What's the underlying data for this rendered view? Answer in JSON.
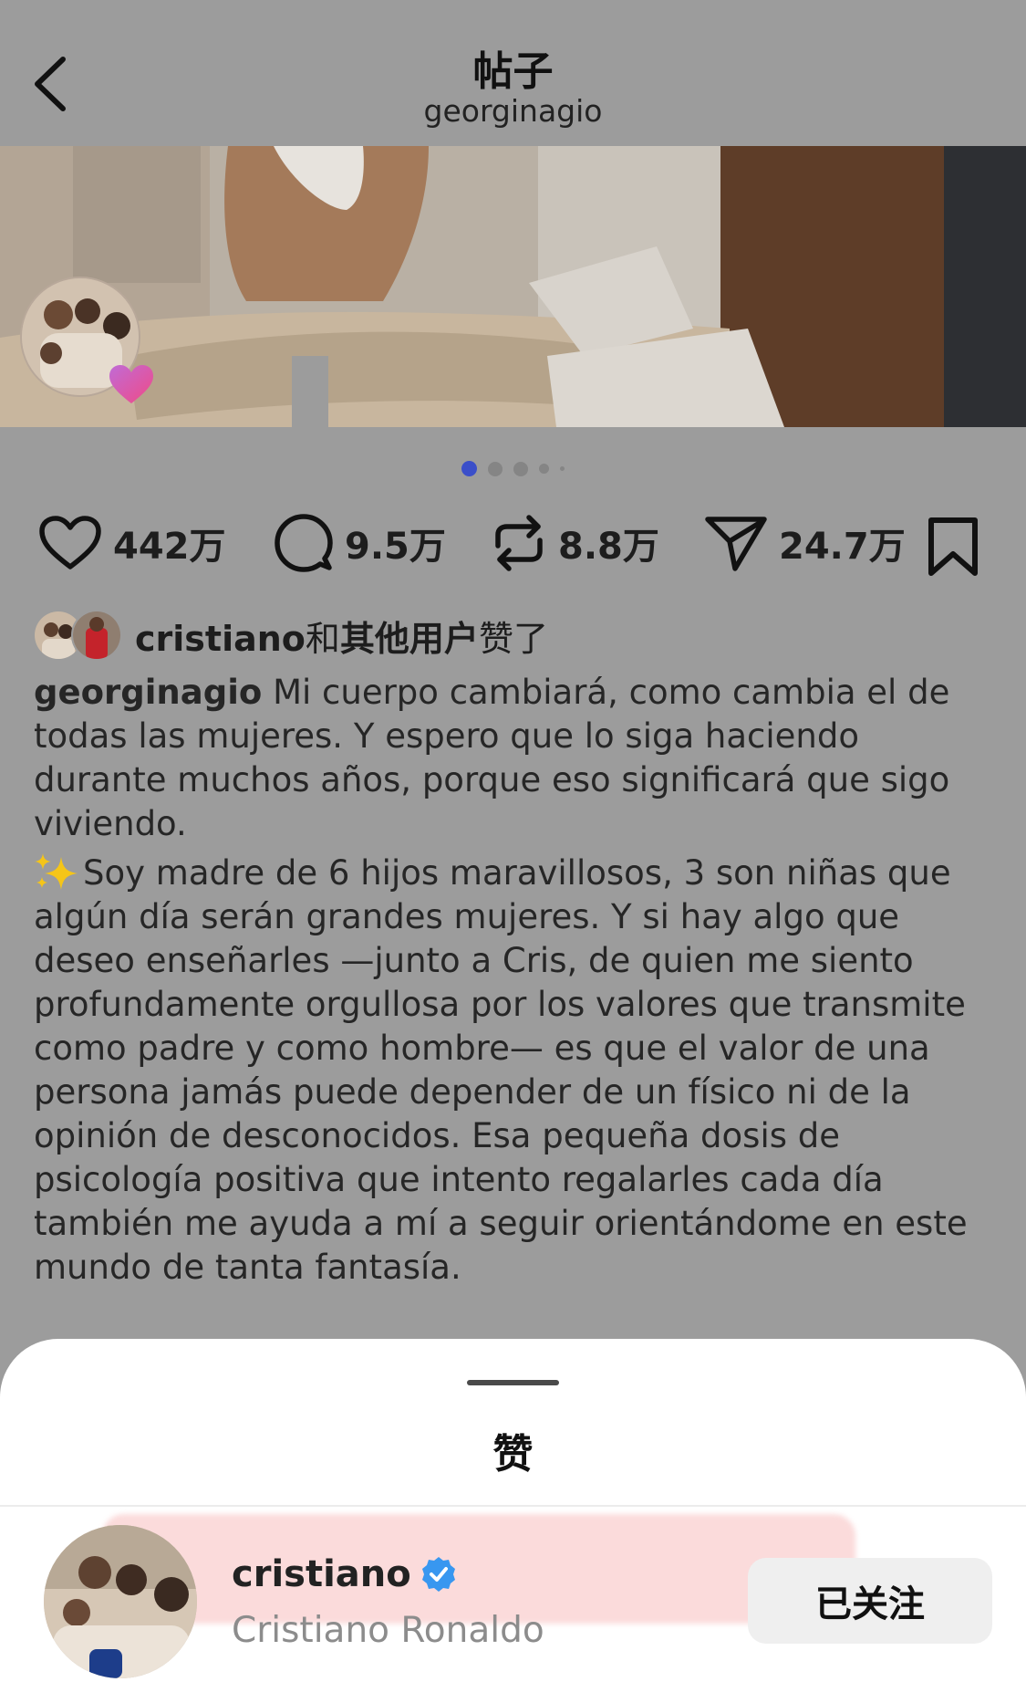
{
  "header": {
    "title": "帖子",
    "subtitle": "georginagio",
    "back_icon": "chevron-left-icon"
  },
  "carousel": {
    "total_slides": 5,
    "active_index": 0
  },
  "actions": {
    "likes": "442万",
    "comments": "9.5万",
    "reposts": "8.8万",
    "shares": "24.7万"
  },
  "liked_by": {
    "username": "cristiano",
    "conjunction": "和",
    "others": "其他用户",
    "suffix": "赞了"
  },
  "caption": {
    "author": "georginagio",
    "paragraph1": "Mi cuerpo cambiará, como cambia el de todas las mujeres. Y espero que lo siga haciendo durante muchos años, porque eso significará que sigo viviendo.",
    "paragraph2": "Soy madre de 6 hijos maravillosos, 3 son niñas que algún día serán grandes mujeres. Y si hay algo que deseo enseñarles —junto a Cris, de quien me siento profundamente orgullosa por los valores que transmite como padre y como hombre— es que el valor de una persona jamás puede depender de un físico ni de la opinión de desconocidos. Esa pequeña dosis de psicología positiva que intento regalarles cada día también me ayuda a mí a seguir orientándome en este mundo de tanta fantasía."
  },
  "likes_sheet": {
    "title": "赞",
    "user": {
      "username": "cristiano",
      "full_name": "Cristiano Ronaldo",
      "verified": true,
      "follow_label": "已关注"
    }
  },
  "colors": {
    "background_dim": "#9c9c9c",
    "active_dot": "#3b4fc9",
    "verified_badge": "#3897f0"
  }
}
